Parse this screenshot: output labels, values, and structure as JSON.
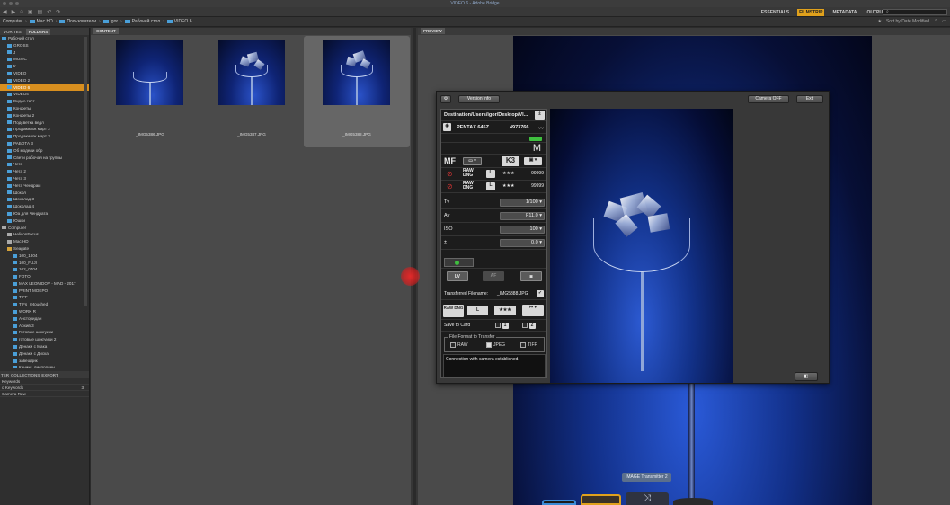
{
  "window": {
    "title": "VIDEO 6 - Adobe Bridge"
  },
  "workspaces": {
    "items": [
      "ESSENTIALS",
      "FILMSTRIP",
      "METADATA",
      "OUTPUT"
    ],
    "active": "FILMSTRIP"
  },
  "search": {
    "placeholder": ""
  },
  "path": {
    "items": [
      "Computer",
      "Mac HD",
      "Пользователи",
      "igor",
      "Рабочий стол",
      "VIDEO 6"
    ]
  },
  "sort": {
    "label": "Sort by Date Modified"
  },
  "left_panel": {
    "tabs": [
      "VORITES",
      "FOLDERS"
    ],
    "folders": [
      {
        "label": "Рабочий стол",
        "level": 0
      },
      {
        "label": "GROSS",
        "level": 1
      },
      {
        "label": "J",
        "level": 1
      },
      {
        "label": "MUSIC",
        "level": 1
      },
      {
        "label": "tr",
        "level": 1
      },
      {
        "label": "VIDEO",
        "level": 1
      },
      {
        "label": "VIDEO 2",
        "level": 1
      },
      {
        "label": "VIDEO 6",
        "level": 1,
        "active": true
      },
      {
        "label": "VIDEO4",
        "level": 1
      },
      {
        "label": "Видео тест",
        "level": 1
      },
      {
        "label": "Конфеты",
        "level": 1
      },
      {
        "label": "Конфеты 2",
        "level": 1
      },
      {
        "label": "Подсветка ведл",
        "level": 1
      },
      {
        "label": "Продакилок март 2",
        "level": 1
      },
      {
        "label": "Продакилок март 3",
        "level": 1
      },
      {
        "label": "РАБОТА 3",
        "level": 1
      },
      {
        "label": "Об модели обр",
        "level": 1
      },
      {
        "label": "Свети рабочая на группы",
        "level": 1
      },
      {
        "label": "Чета",
        "level": 1
      },
      {
        "label": "Чета 2",
        "level": 1
      },
      {
        "label": "Чета 3",
        "level": 1
      },
      {
        "label": "Чета Чендрам",
        "level": 1
      },
      {
        "label": "Шокол",
        "level": 1
      },
      {
        "label": "Шоколад 3",
        "level": 1
      },
      {
        "label": "Шоколад 4",
        "level": 1
      },
      {
        "label": "Юа для Чендрата",
        "level": 1
      },
      {
        "label": "Юшки",
        "level": 1
      },
      {
        "label": "Computer",
        "level": 0,
        "drive": true
      },
      {
        "label": "HeliconFocus",
        "level": 1,
        "drive": true
      },
      {
        "label": "Mac HD",
        "level": 1,
        "drive": true
      },
      {
        "label": "Seagate",
        "level": 1,
        "yellow": true
      },
      {
        "label": "100_1804",
        "level": 2
      },
      {
        "label": "100_FUJI",
        "level": 2
      },
      {
        "label": "102_0704",
        "level": 2
      },
      {
        "label": "FOTO",
        "level": 2
      },
      {
        "label": "MAX LEONIDOV - MAD - 2017",
        "level": 2
      },
      {
        "label": "PRINT MOEPO",
        "level": 2
      },
      {
        "label": "TIFF",
        "level": 2
      },
      {
        "label": "TIFs_retouched",
        "level": 2
      },
      {
        "label": "WORK R",
        "level": 2
      },
      {
        "label": "Ансторидан",
        "level": 2
      },
      {
        "label": "Архив 3",
        "level": 2
      },
      {
        "label": "Готовые шокгуики",
        "level": 2
      },
      {
        "label": "готовые шокгуики 2",
        "level": 2
      },
      {
        "label": "Денаки с Мака",
        "level": 2
      },
      {
        "label": "Денаки с Диска",
        "level": 2
      },
      {
        "label": "завещдик",
        "level": 2
      },
      {
        "label": "Каникс_виспорден",
        "level": 2
      }
    ],
    "bottom_tabs": [
      "TER",
      "COLLECTIONS",
      "EXPORT"
    ],
    "filters": [
      {
        "label": "Keywords",
        "count": ""
      },
      {
        "label": "o Keywords",
        "count": "3"
      },
      {
        "label": "Camera Raw",
        "count": ""
      }
    ]
  },
  "content_panel": {
    "title": "CONTENT",
    "thumbnails": [
      {
        "name": "_IMG5386.JPG",
        "selected": false
      },
      {
        "name": "_IMG5387.JPG",
        "selected": false
      },
      {
        "name": "_IMG5388.JPG",
        "selected": true
      }
    ]
  },
  "preview_panel": {
    "title": "PREVIEW"
  },
  "dialog": {
    "version_button": "Version info",
    "camera_off_button": "Camera OFF",
    "exit_button": "Exit",
    "destination_label": "Destination",
    "destination_value": "/Users/igor/Desktop/VI...",
    "camera_model": "PENTAX 645Z",
    "camera_serial": "4973766",
    "mode_label": "M",
    "focus_mode": "MF",
    "jpeg_quality_badge": "K3",
    "raw_rows": [
      {
        "format": "RAW DNG",
        "size": "L",
        "stars": "★★★",
        "shots": "99999"
      },
      {
        "format": "RAW DNG",
        "size": "L",
        "stars": "★★★",
        "shots": "99999"
      }
    ],
    "exposure": [
      {
        "label": "Tv",
        "value": "1/100"
      },
      {
        "label": "Av",
        "value": "F11.0"
      },
      {
        "label": "ISO",
        "value": "100"
      },
      {
        "label": "±",
        "value": "0.0"
      }
    ],
    "lv_label": "LV",
    "af_label": "AF",
    "transferred_label": "Transferred Filename:",
    "transferred_value": "_IMG5388.JPG",
    "save_format": "RAW DNG",
    "save_size": "L",
    "save_stars": "★★★",
    "save_to_card_label": "Save to Card",
    "slot1": "1",
    "slot2": "2",
    "file_format_legend": "File Format to Transfer",
    "formats": [
      {
        "label": "RAW",
        "checked": false
      },
      {
        "label": "JPEG",
        "checked": true
      },
      {
        "label": "TIFF",
        "checked": false
      }
    ],
    "status_message": "Connection with camera established."
  },
  "dock": {
    "tooltip": "IMAGE Transmitter 2"
  },
  "colors": {
    "accent": "#e0a11c",
    "selection": "#d88f1f",
    "folder": "#4a9fd8"
  }
}
